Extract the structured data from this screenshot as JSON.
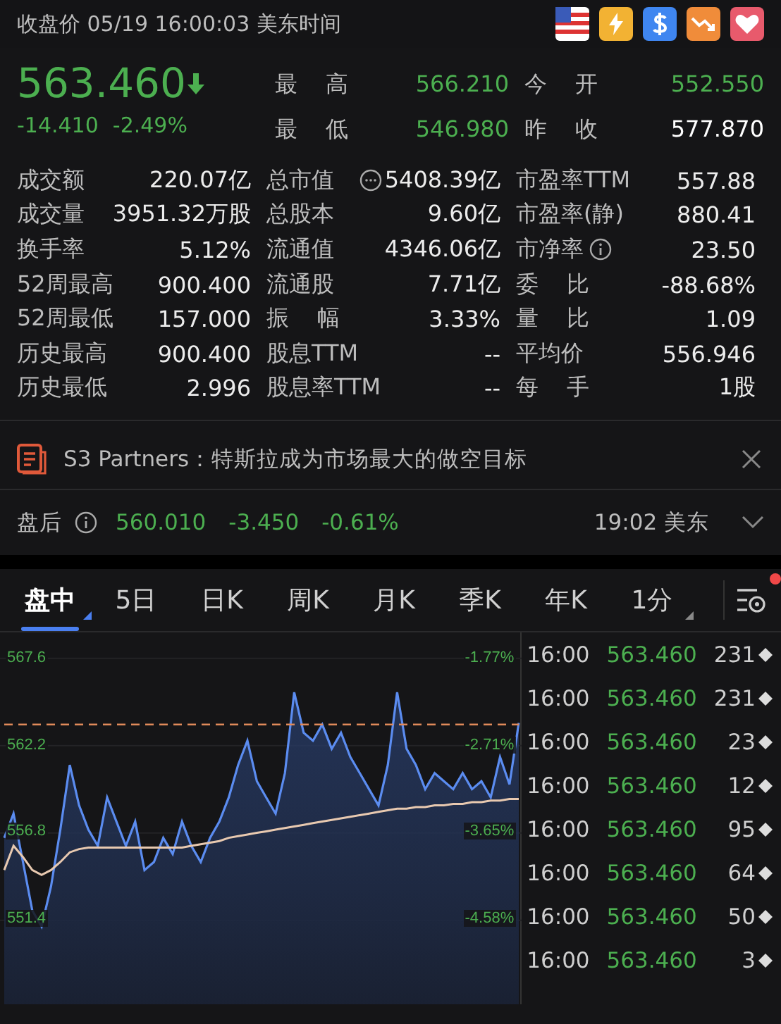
{
  "header": {
    "title": "收盘价 05/19 16:00:03 美东时间"
  },
  "quote": {
    "price": "563.460",
    "change": "-14.410",
    "change_pct": "-2.49%"
  },
  "quote_stats": [
    {
      "label": "最高",
      "value": "566.210",
      "color": "#4caf50"
    },
    {
      "label": "今开",
      "value": "552.550",
      "color": "#4caf50"
    },
    {
      "label": "最低",
      "value": "546.980",
      "color": "#4caf50"
    },
    {
      "label": "昨收",
      "value": "577.870",
      "color": "#ffffff"
    }
  ],
  "stats": [
    [
      {
        "label": "成交额",
        "value": "220.07亿",
        "kind": "plain",
        "spaced": false
      },
      {
        "label": "总市值",
        "value": "5408.39亿",
        "kind": "more",
        "spaced": false
      },
      {
        "label": "市盈率TTM",
        "value": "557.88",
        "kind": "plain",
        "spaced": false
      }
    ],
    [
      {
        "label": "成交量",
        "value": "3951.32万股",
        "kind": "plain",
        "spaced": false
      },
      {
        "label": "总股本",
        "value": "9.60亿",
        "kind": "plain",
        "spaced": false
      },
      {
        "label": "市盈率(静)",
        "value": "880.41",
        "kind": "plain",
        "spaced": false
      }
    ],
    [
      {
        "label": "换手率",
        "value": "5.12%",
        "kind": "plain",
        "spaced": false
      },
      {
        "label": "流通值",
        "value": "4346.06亿",
        "kind": "plain",
        "spaced": false
      },
      {
        "label": "市净率",
        "value": "23.50",
        "kind": "info",
        "spaced": false
      }
    ],
    [
      {
        "label": "52周最高",
        "value": "900.400",
        "kind": "plain",
        "spaced": false
      },
      {
        "label": "流通股",
        "value": "7.71亿",
        "kind": "plain",
        "spaced": false
      },
      {
        "label": "委比",
        "value": "-88.68%",
        "kind": "plain",
        "spaced": true
      }
    ],
    [
      {
        "label": "52周最低",
        "value": "157.000",
        "kind": "plain",
        "spaced": false
      },
      {
        "label": "振幅",
        "value": "3.33%",
        "kind": "plain",
        "spaced": true
      },
      {
        "label": "量比",
        "value": "1.09",
        "kind": "plain",
        "spaced": true
      }
    ],
    [
      {
        "label": "历史最高",
        "value": "900.400",
        "kind": "plain",
        "spaced": false
      },
      {
        "label": "股息TTM",
        "value": "--",
        "kind": "plain",
        "spaced": false
      },
      {
        "label": "平均价",
        "value": "556.946",
        "kind": "plain",
        "spaced": false
      }
    ],
    [
      {
        "label": "历史最低",
        "value": "2.996",
        "kind": "plain",
        "spaced": false
      },
      {
        "label": "股息率TTM",
        "value": "--",
        "kind": "plain",
        "spaced": false
      },
      {
        "label": "每手",
        "value": "1股",
        "kind": "plain",
        "spaced": true
      }
    ]
  ],
  "news": {
    "text": "S3 Partners：特斯拉成为市场最大的做空目标"
  },
  "after_hours": {
    "label": "盘后",
    "price": "560.010",
    "change": "-3.450",
    "change_pct": "-0.61%",
    "time": "19:02 美东"
  },
  "tabs": [
    {
      "label": "盘中",
      "selected": true,
      "has_options": true
    },
    {
      "label": "5日",
      "selected": false,
      "has_options": false
    },
    {
      "label": "日K",
      "selected": false,
      "has_options": false
    },
    {
      "label": "周K",
      "selected": false,
      "has_options": false
    },
    {
      "label": "月K",
      "selected": false,
      "has_options": false
    },
    {
      "label": "季K",
      "selected": false,
      "has_options": false
    },
    {
      "label": "年K",
      "selected": false,
      "has_options": false
    },
    {
      "label": "1分",
      "selected": false,
      "has_options": true
    }
  ],
  "chart": {
    "pct_labels": [
      "-1.77%",
      "-2.71%",
      "-3.65%",
      "-4.58%"
    ],
    "chart_data": {
      "type": "line",
      "ylim": [
        546.2,
        569.2
      ],
      "yticks": [
        567.6,
        562.2,
        556.8,
        551.4
      ],
      "grid": true,
      "series": [
        {
          "type": "area",
          "color": "#5b8cf0",
          "values": [
            556.5,
            558.0,
            555.0,
            552.0,
            551.0,
            553.5,
            557.0,
            561.0,
            558.5,
            557.0,
            556.0,
            559.0,
            557.5,
            556.0,
            557.5,
            554.5,
            555.0,
            556.5,
            555.5,
            557.5,
            556.0,
            555.0,
            556.5,
            557.5,
            559.0,
            561.0,
            562.5,
            560.0,
            559.0,
            558.0,
            560.5,
            565.5,
            563.0,
            562.5,
            563.5,
            562.0,
            563.0,
            561.5,
            560.5,
            559.5,
            558.5,
            561.0,
            565.5,
            562.0,
            561.0,
            559.5,
            560.5,
            560.0,
            559.5,
            560.5,
            559.5,
            560.0,
            559.0,
            561.5,
            559.8,
            563.6
          ]
        },
        {
          "type": "line",
          "line_style": "dashed",
          "color": "#e08a5a",
          "values": [
            563.5,
            563.5,
            563.5,
            563.5,
            563.5,
            563.5,
            563.5,
            563.5,
            563.5,
            563.5,
            563.5,
            563.5,
            563.5,
            563.5,
            563.5,
            563.5,
            563.5,
            563.5,
            563.5,
            563.5,
            563.5,
            563.5,
            563.5,
            563.5,
            563.5,
            563.5,
            563.5,
            563.5,
            563.5,
            563.5,
            563.5,
            563.5,
            563.5,
            563.5,
            563.5,
            563.5,
            563.5,
            563.5,
            563.5,
            563.5,
            563.5,
            563.5,
            563.5,
            563.5,
            563.5,
            563.5,
            563.5,
            563.5,
            563.5,
            563.5,
            563.5,
            563.5,
            563.5,
            563.5,
            563.5,
            563.5
          ]
        },
        {
          "type": "line",
          "color": "#e8c9b0",
          "values": [
            554.5,
            556.0,
            555.3,
            554.5,
            554.2,
            554.5,
            555.0,
            555.6,
            555.8,
            555.9,
            555.9,
            555.9,
            555.9,
            555.9,
            555.9,
            555.9,
            555.9,
            555.9,
            555.9,
            555.9,
            556.0,
            556.1,
            556.2,
            556.3,
            556.5,
            556.6,
            556.7,
            556.8,
            556.9,
            557.0,
            557.1,
            557.2,
            557.3,
            557.4,
            557.5,
            557.6,
            557.7,
            557.8,
            557.9,
            558.0,
            558.1,
            558.2,
            558.3,
            558.3,
            558.4,
            558.4,
            558.5,
            558.5,
            558.6,
            558.6,
            558.7,
            558.7,
            558.8,
            558.8,
            558.9,
            558.9
          ]
        }
      ]
    }
  },
  "trades": [
    {
      "time": "16:00",
      "price": "563.460",
      "volume": "231"
    },
    {
      "time": "16:00",
      "price": "563.460",
      "volume": "231"
    },
    {
      "time": "16:00",
      "price": "563.460",
      "volume": "23"
    },
    {
      "time": "16:00",
      "price": "563.460",
      "volume": "12"
    },
    {
      "time": "16:00",
      "price": "563.460",
      "volume": "95"
    },
    {
      "time": "16:00",
      "price": "563.460",
      "volume": "64"
    },
    {
      "time": "16:00",
      "price": "563.460",
      "volume": "50"
    },
    {
      "time": "16:00",
      "price": "563.460",
      "volume": "3"
    }
  ]
}
